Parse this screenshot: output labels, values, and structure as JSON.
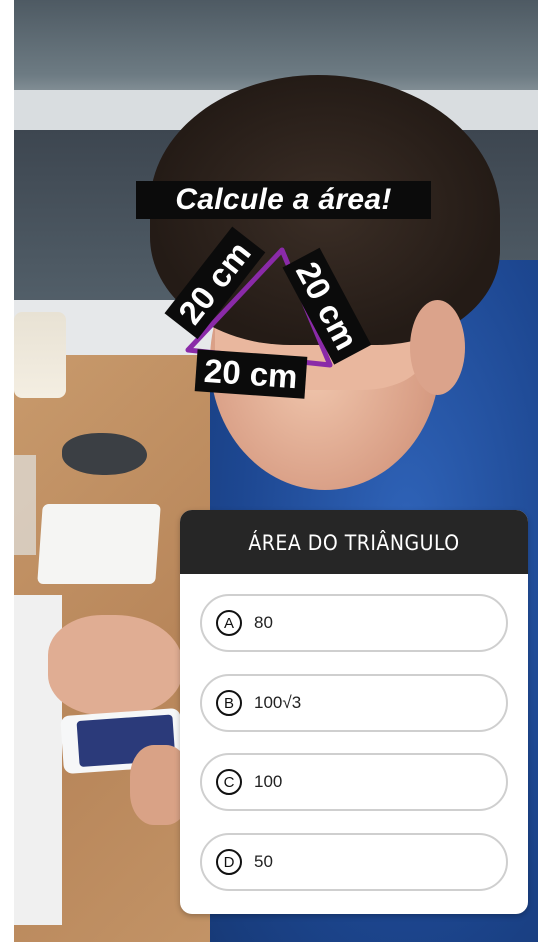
{
  "sticker": {
    "title": "Calcule a área!",
    "side_left": "20 cm",
    "side_right": "20 cm",
    "side_bottom": "20 cm",
    "triangle_color": "#8a2aa8"
  },
  "quiz": {
    "header": "ÁREA DO TRIÂNGULO",
    "options": [
      {
        "letter": "A",
        "value": "80"
      },
      {
        "letter": "B",
        "value": "100√3"
      },
      {
        "letter": "C",
        "value": "100"
      },
      {
        "letter": "D",
        "value": "50"
      }
    ]
  }
}
